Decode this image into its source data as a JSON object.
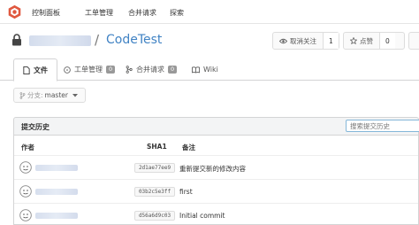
{
  "nav": {
    "items": [
      "控制面板",
      "工单管理",
      "合并请求",
      "探索"
    ]
  },
  "repo": {
    "separator": "/",
    "name": "CodeTest",
    "watch_label": "取消关注",
    "watch_count": "1",
    "star_label": "点赞",
    "star_count": "0"
  },
  "tabs": [
    {
      "label": "文件"
    },
    {
      "label": "工单管理",
      "count": "0"
    },
    {
      "label": "合并请求",
      "count": "0"
    },
    {
      "label": "Wiki"
    }
  ],
  "branch": {
    "prefix": "分支:",
    "name": "master"
  },
  "commits": {
    "title": "提交历史",
    "search_placeholder": "搜索提交历史",
    "columns": [
      "作者",
      "SHA1",
      "备注"
    ],
    "rows": [
      {
        "sha": "2d1ae77ee9",
        "message": "重新提交新的修改内容"
      },
      {
        "sha": "03b2c5e3ff",
        "message": "first"
      },
      {
        "sha": "d56a6d9c03",
        "message": "Initial commit"
      }
    ]
  },
  "colors": {
    "accent": "#4183c4",
    "logo": "#e0583f"
  },
  "icons": [
    "gitea-logo-icon",
    "lock-icon",
    "eye-icon",
    "star-icon",
    "file-icon",
    "issue-icon",
    "merge-icon",
    "book-icon",
    "branch-icon",
    "chevron-down-icon",
    "avatar-icon"
  ]
}
